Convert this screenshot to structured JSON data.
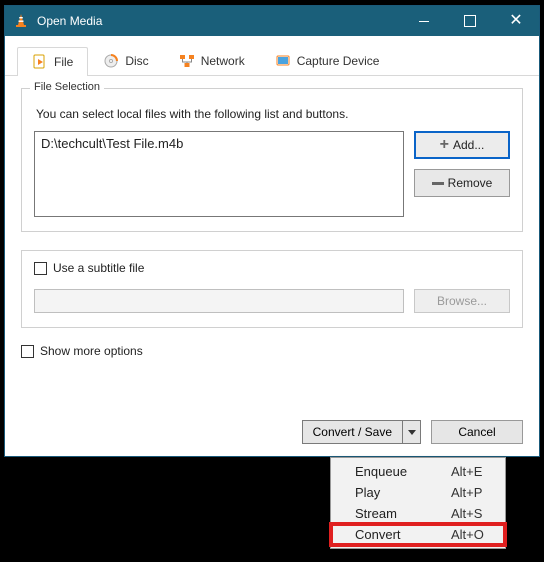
{
  "titlebar": {
    "title": "Open Media"
  },
  "tabs": {
    "file": "File",
    "disc": "Disc",
    "network": "Network",
    "capture": "Capture Device"
  },
  "fileSelection": {
    "legend": "File Selection",
    "help": "You can select local files with the following list and buttons.",
    "items": [
      "D:\\techcult\\Test File.m4b"
    ],
    "add_label": "Add...",
    "remove_label": "Remove"
  },
  "subtitle": {
    "checkbox_label": "Use a subtitle file",
    "browse_label": "Browse..."
  },
  "more_options_label": "Show more options",
  "actions": {
    "convert_save": "Convert / Save",
    "cancel": "Cancel"
  },
  "menu": {
    "enqueue": {
      "label": "Enqueue",
      "shortcut": "Alt+E"
    },
    "play": {
      "label": "Play",
      "shortcut": "Alt+P"
    },
    "stream": {
      "label": "Stream",
      "shortcut": "Alt+S"
    },
    "convert": {
      "label": "Convert",
      "shortcut": "Alt+O"
    }
  }
}
